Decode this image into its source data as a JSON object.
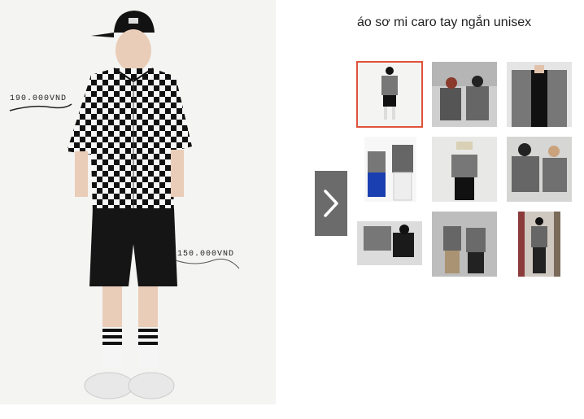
{
  "product": {
    "title": "áo sơ mi caro tay ngắn unisex"
  },
  "main_image": {
    "price_shirt": "190.000VND",
    "price_shorts": "150.000VND",
    "selected_thumbnail": 1
  },
  "gallery": {
    "next_icon": "chevron-right-icon",
    "thumbnail_count": 9
  },
  "colors": {
    "accent_selected": "#e0523a",
    "next_button_bg": "#6b6b6b"
  }
}
